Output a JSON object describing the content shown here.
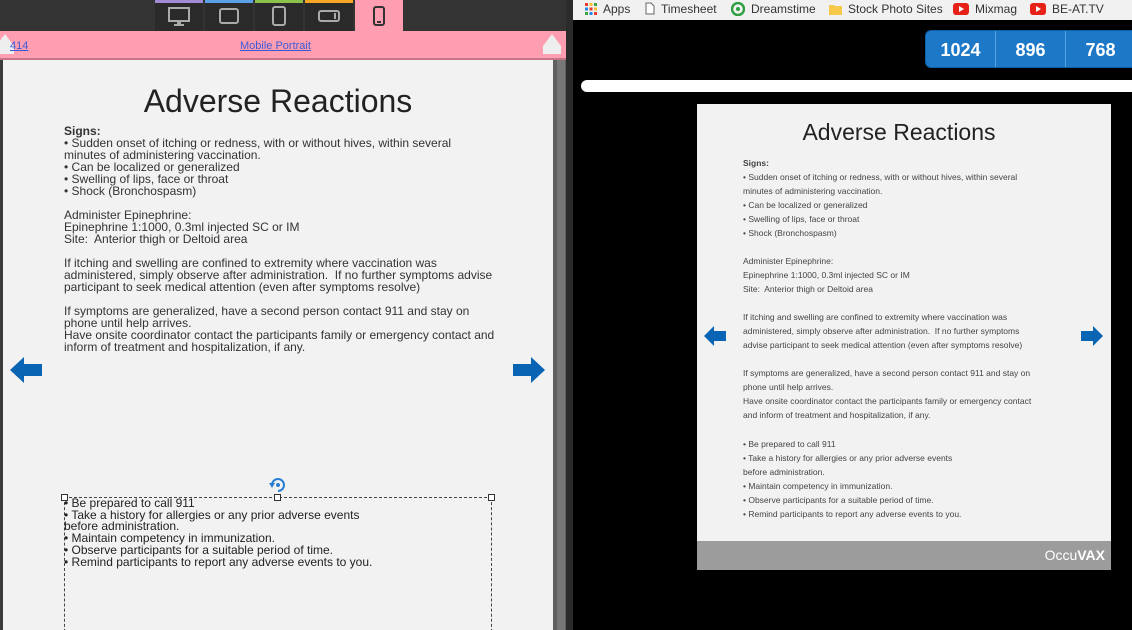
{
  "editor": {
    "width_label": "414",
    "device_label": "Mobile Portrait",
    "slide": {
      "title": "Adverse Reactions",
      "signs_label": "Signs:",
      "signs": [
        "• Sudden onset of itching or redness, with or without hives, within several",
        "minutes of administering vaccination.",
        "• Can be localized or generalized",
        "• Swelling of lips, face or throat",
        "• Shock (Bronchospasm)"
      ],
      "epinephrine": [
        "Administer Epinephrine:",
        "Epinephrine 1:1000, 0.3ml injected SC or IM",
        "Site:  Anterior thigh or Deltoid area"
      ],
      "confined": [
        "If itching and swelling are confined to extremity where vaccination was",
        "administered, simply observe after administration.  If no further symptoms advise",
        "participant to seek medical attention (even after symptoms resolve)"
      ],
      "generalized": [
        "If symptoms are generalized, have a second person contact 911 and stay on",
        "phone until help arrives.",
        "Have onsite coordinator contact the participants family or emergency contact and",
        "inform of treatment and hospitalization, if any."
      ],
      "checklist": [
        "• Be prepared to call 911",
        "• Take a history for allergies or any prior adverse events",
        "before administration.",
        "• Maintain competency in immunization.",
        "• Observe participants for a suitable period of time.",
        "• Remind participants to report any adverse events to you."
      ]
    }
  },
  "browser": {
    "bookmarks": [
      {
        "label": "Apps",
        "icon": "apps-grid-icon"
      },
      {
        "label": "Timesheet",
        "icon": "page-icon"
      },
      {
        "label": "Dreamstime",
        "icon": "dreamstime-icon"
      },
      {
        "label": "Stock Photo Sites",
        "icon": "folder-icon"
      },
      {
        "label": "Mixmag",
        "icon": "youtube-icon"
      },
      {
        "label": "BE-AT.TV",
        "icon": "youtube-icon"
      }
    ],
    "breakpoints": [
      "1024",
      "896",
      "768"
    ],
    "slide": {
      "title": "Adverse Reactions",
      "signs_label": "Signs:",
      "signs": [
        "• Sudden onset of itching or redness, with or without hives, within several",
        "minutes of administering vaccination.",
        "• Can be localized or generalized",
        "• Swelling of lips, face or throat",
        "• Shock (Bronchospasm)"
      ],
      "epinephrine": [
        "Administer Epinephrine:",
        "Epinephrine 1:1000, 0.3ml injected SC or IM",
        "Site:  Anterior thigh or Deltoid area"
      ],
      "confined": [
        "If itching and swelling are confined to extremity where vaccination was",
        "administered, simply observe after administration.  If no further symptoms",
        "advise participant to seek medical attention (even after symptoms resolve)"
      ],
      "generalized": [
        "If symptoms are generalized, have a second person contact 911 and stay on",
        "phone until help arrives.",
        "Have onsite coordinator contact the participants family or emergency contact",
        "and inform of treatment and hospitalization, if any."
      ],
      "checklist": [
        "• Be prepared to call 911",
        "• Take a history for allergies or any prior adverse events",
        "before administration.",
        "• Maintain competency in immunization.",
        "• Observe participants for a suitable period of time.",
        "• Remind participants to report any adverse events to you."
      ],
      "brand_name_a": "Occu",
      "brand_name_b": "VAX"
    }
  },
  "colors": {
    "device_bar_accent": "#ff9db1",
    "breakpoint_blue": "#1e78c8",
    "arrow_blue": "#0a64b4"
  }
}
